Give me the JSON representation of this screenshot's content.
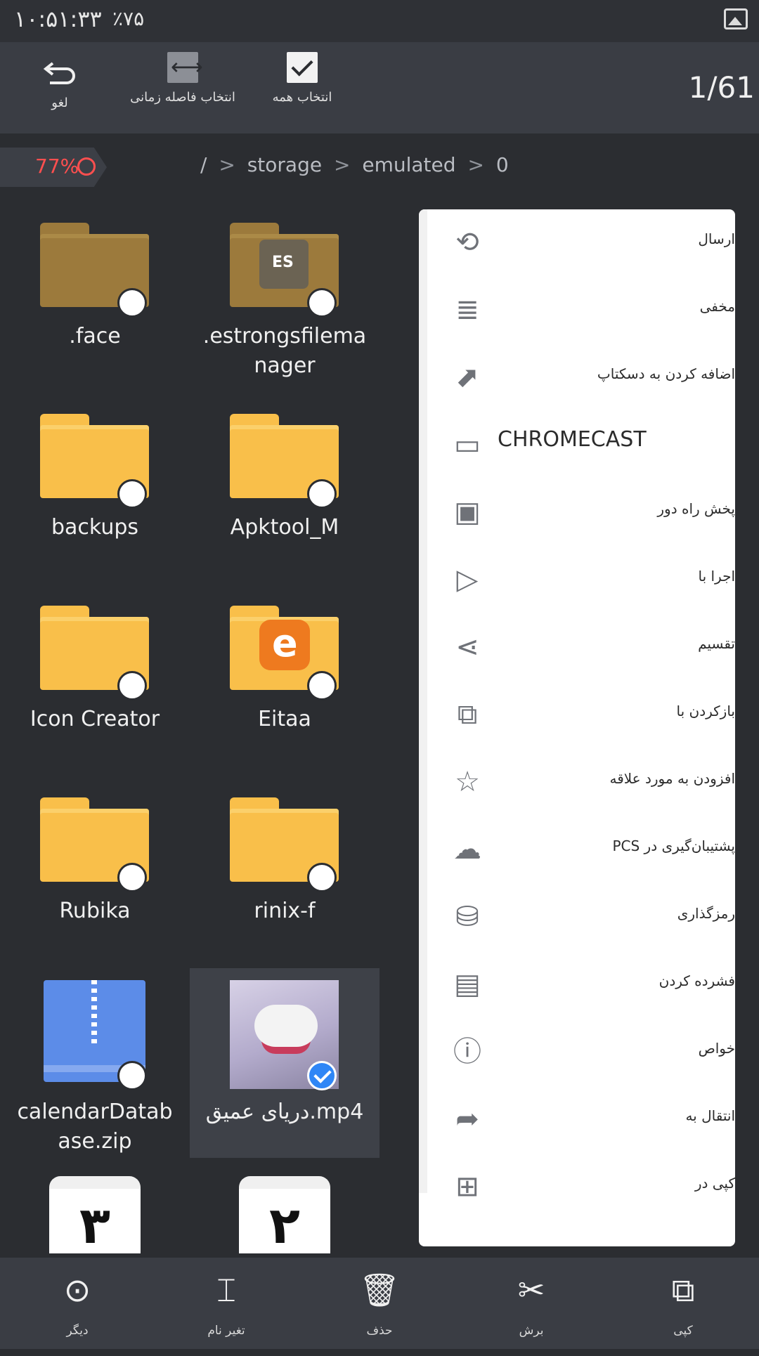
{
  "status_bar": {
    "time": "۱۰:۵۱:۳۳",
    "battery_text": "٪۷۵"
  },
  "toolbar": {
    "undo_label": "لغو",
    "select_range_label": "انتخاب فاصله زمانی",
    "select_all_label": "انتخاب همه",
    "counter": "1/61"
  },
  "path_bar": {
    "storage_percent": "77%",
    "crumbs": [
      "/",
      "storage",
      "emulated",
      "0"
    ]
  },
  "files": [
    {
      "name": ".face",
      "type": "folder",
      "variant": "brown"
    },
    {
      "name": ".estrongsfilemanager",
      "type": "folder",
      "variant": "brown",
      "line1": ".estrongsfilema",
      "line2": "nager"
    },
    {
      "name": "backups",
      "type": "folder",
      "variant": "yellow"
    },
    {
      "name": "Apktool_M",
      "type": "folder",
      "variant": "yellow"
    },
    {
      "name": "Icon Creator",
      "type": "folder",
      "variant": "yellow"
    },
    {
      "name": "Eitaa",
      "type": "folder",
      "variant": "yellow"
    },
    {
      "name": "Rubika",
      "type": "folder",
      "variant": "yellow"
    },
    {
      "name": "rinix-f",
      "type": "folder",
      "variant": "yellow"
    },
    {
      "name": "calendarDatabase.zip",
      "type": "zip",
      "line1": "calendarDatab",
      "line2": "ase.zip"
    },
    {
      "name": "دریای عمیق.mp4",
      "type": "video",
      "selected": true
    },
    {
      "name": "",
      "type": "calendar",
      "day": "۳"
    },
    {
      "name": "",
      "type": "calendar",
      "day": "۲"
    }
  ],
  "context_menu": {
    "items": [
      {
        "label": "ارسال",
        "icon": "send-icon"
      },
      {
        "label": "مخفی",
        "icon": "hide-icon"
      },
      {
        "label": "اضافه کردن به دسکتاپ",
        "icon": "add-to-desktop-icon"
      },
      {
        "label": "CHROMECAST",
        "icon": "cast-icon"
      },
      {
        "label": "پخش راه دور",
        "icon": "remote-play-icon"
      },
      {
        "label": "اجرا با",
        "icon": "run-with-icon"
      },
      {
        "label": "تقسیم",
        "icon": "share-icon"
      },
      {
        "label": "بازکردن با",
        "icon": "open-with-icon"
      },
      {
        "label": "افزودن به مورد علاقه",
        "icon": "star-icon"
      },
      {
        "label": "پشتیبان‌گیری در PCS",
        "icon": "cloud-upload-icon"
      },
      {
        "label": "رمزگذاری",
        "icon": "encrypt-icon"
      },
      {
        "label": "فشرده کردن",
        "icon": "compress-icon"
      },
      {
        "label": "خواص",
        "icon": "info-icon"
      },
      {
        "label": "انتقال به",
        "icon": "move-to-icon"
      },
      {
        "label": "کپی در",
        "icon": "copy-to-icon"
      }
    ]
  },
  "bottom_bar": {
    "more_label": "دیگر",
    "rename_label": "تغیر نام",
    "delete_label": "حذف",
    "cut_label": "برش",
    "copy_label": "کپی"
  }
}
